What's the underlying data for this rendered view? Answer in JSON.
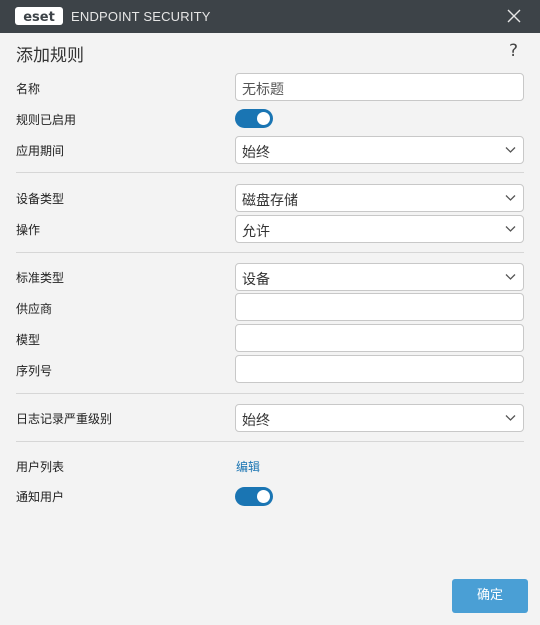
{
  "window": {
    "brand": "eset",
    "app_title": "ENDPOINT SECURITY",
    "close_icon": "close-icon"
  },
  "dialog": {
    "title": "添加规则",
    "help_label": "?"
  },
  "form": {
    "name_label": "名称",
    "name_placeholder": "无标题",
    "rule_enabled_label": "规则已启用",
    "rule_enabled": true,
    "apply_period_label": "应用期间",
    "apply_period_value": "始终",
    "device_type_label": "设备类型",
    "device_type_value": "磁盘存储",
    "action_label": "操作",
    "action_value": "允许",
    "criteria_type_label": "标准类型",
    "criteria_type_value": "设备",
    "vendor_label": "供应商",
    "vendor_value": "",
    "model_label": "模型",
    "model_value": "",
    "serial_label": "序列号",
    "serial_value": "",
    "log_severity_label": "日志记录严重级别",
    "log_severity_value": "始终",
    "user_list_label": "用户列表",
    "user_list_link": "编辑",
    "notify_user_label": "通知用户",
    "notify_user": true
  },
  "footer": {
    "ok_label": "确定"
  },
  "colors": {
    "titlebar": "#3d4348",
    "accent": "#1a75b3",
    "button": "#4a9fd5",
    "background": "#f3f3f3"
  }
}
